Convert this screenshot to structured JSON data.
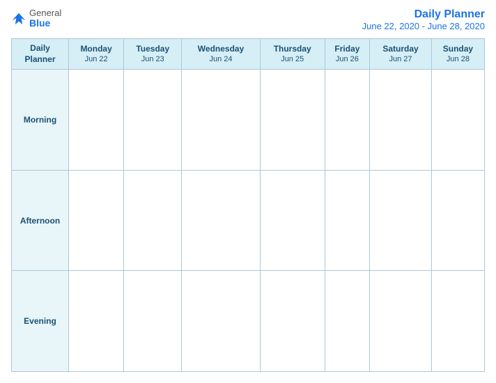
{
  "logo": {
    "general": "General",
    "blue": "Blue"
  },
  "title": {
    "main": "Daily Planner",
    "sub": "June 22, 2020 - June 28, 2020"
  },
  "table": {
    "header_label": "Daily\nPlanner",
    "columns": [
      {
        "day": "Monday",
        "date": "Jun 22"
      },
      {
        "day": "Tuesday",
        "date": "Jun 23"
      },
      {
        "day": "Wednesday",
        "date": "Jun 24"
      },
      {
        "day": "Thursday",
        "date": "Jun 25"
      },
      {
        "day": "Friday",
        "date": "Jun 26"
      },
      {
        "day": "Saturday",
        "date": "Jun 27"
      },
      {
        "day": "Sunday",
        "date": "Jun 28"
      }
    ],
    "rows": [
      {
        "label": "Morning"
      },
      {
        "label": "Afternoon"
      },
      {
        "label": "Evening"
      }
    ]
  }
}
